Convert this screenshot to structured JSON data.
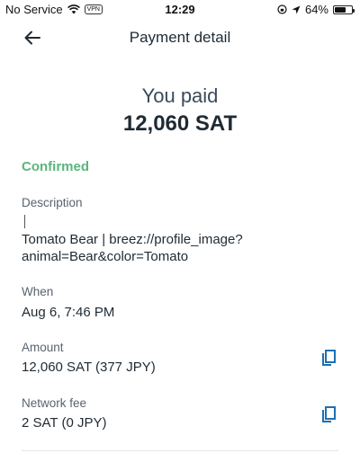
{
  "status_bar": {
    "carrier": "No Service",
    "vpn": "VPN",
    "time": "12:29",
    "battery": "64%",
    "battery_level": 0.64
  },
  "header": {
    "title": "Payment detail",
    "back_icon": "arrow-left-icon"
  },
  "summary": {
    "label": "You paid",
    "amount": "12,060 SAT"
  },
  "status": "Confirmed",
  "fields": {
    "description": {
      "label": "Description",
      "value_line1": "Tomato Bear | breez://profile_image?",
      "value_line2": "animal=Bear&color=Tomato"
    },
    "when": {
      "label": "When",
      "value": "Aug 6, 7:46 PM"
    },
    "amount": {
      "label": "Amount",
      "value": "12,060 SAT (377 JPY)"
    },
    "network_fee": {
      "label": "Network fee",
      "value": "2 SAT (0 JPY)"
    }
  },
  "colors": {
    "accent": "#1e6fb3",
    "confirmed": "#5bb57b",
    "text": "#1f2a33",
    "label": "#59636e"
  }
}
